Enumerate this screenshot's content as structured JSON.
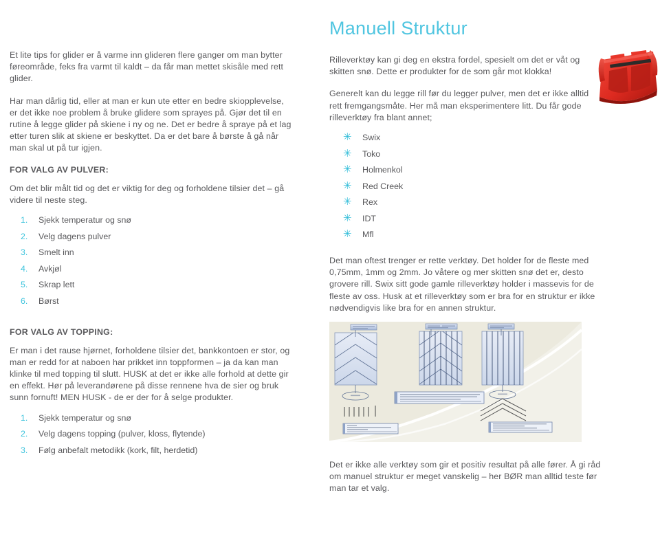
{
  "colors": {
    "accent_cyan": "#3ec4dd",
    "title_cyan": "#4fc5e0",
    "body_text": "#58585b",
    "tool_red": "#e03127",
    "diagram_bg": "#eceade",
    "panel_fill": "#dde4f0"
  },
  "left_column": {
    "paragraph_1": "Et lite tips for glider er å varme inn glideren flere ganger om man bytter føreområde, feks fra varmt til kaldt – da får man mettet skisåle med rett glider.",
    "paragraph_2": "Har man dårlig tid, eller at man er kun ute etter en bedre skiopplevelse, er det ikke noe problem å bruke glidere som sprayes på. Gjør det til en rutine å legge glider på skiene i ny og ne. Det er bedre å spraye på et lag etter turen slik at skiene er beskyttet. Da er det bare å børste å gå når man skal ut på tur igjen.",
    "pulver_heading": "FOR VALG AV PULVER:",
    "pulver_intro": "Om det blir målt tid og det er viktig for deg og forholdene tilsier det – gå videre til neste steg.",
    "pulver_steps": [
      {
        "number": "1.",
        "label": "Sjekk temperatur og snø"
      },
      {
        "number": "2.",
        "label": "Velg dagens pulver"
      },
      {
        "number": "3.",
        "label": "Smelt inn"
      },
      {
        "number": "4.",
        "label": "Avkjøl"
      },
      {
        "number": "5.",
        "label": "Skrap lett"
      },
      {
        "number": "6.",
        "label": "Børst"
      }
    ],
    "topping_heading": "FOR VALG AV TOPPING:",
    "topping_intro": "Er man i det rause hjørnet, forholdene tilsier det, bankkontoen er stor, og man er redd for at naboen har prikket inn toppformen – ja da kan man klinke til med topping til slutt. HUSK at det er ikke alle forhold at dette gir en effekt. Hør på leverandørene på disse rennene hva de sier og bruk sunn fornuft! MEN HUSK - de er der for å selge produkter.",
    "topping_steps": [
      {
        "number": "1.",
        "label": "Sjekk temperatur og snø"
      },
      {
        "number": "2.",
        "label": "Velg dagens topping (pulver, kloss, flytende)"
      },
      {
        "number": "3.",
        "label": "Følg anbefalt metodikk (kork, filt, herdetid)"
      }
    ]
  },
  "right_column": {
    "title": "Manuell Struktur",
    "paragraph_1": "Rilleverktøy kan gi deg en ekstra fordel, spesielt om det er våt og skitten snø. Dette er produkter for de som går mot klokka!",
    "paragraph_2": "Generelt kan du legge rill før du legger pulver, men det er ikke alltid rett fremgangsmåte. Her må man eksperimentere litt.  Du får gode rilleverktøy fra blant annet;",
    "brand_bullet": "✳",
    "brands": [
      "Swix",
      "Toko",
      "Holmenkol",
      "Red Creek",
      "Rex",
      "IDT",
      "Mfl"
    ],
    "paragraph_3": "Det man oftest trenger er rette verktøy. Det holder for de fleste med 0,75mm, 1mm og 2mm. Jo våtere og mer skitten snø det er, desto grovere rill. Swix sitt gode gamle rilleverktøy holder i massevis for de fleste av oss. Husk at et rilleverktøy som er bra for en struktur er ikke nødvendigvis like bra for en annen struktur.",
    "paragraph_4": "Det er ikke alle verktøy som gir et positiv resultat på alle fører. Å gi råd om manuel struktur er meget vanskelig – her BØR man alltid teste før man tar et valg.",
    "tool_photo_alt": "rille-tool-photo"
  }
}
